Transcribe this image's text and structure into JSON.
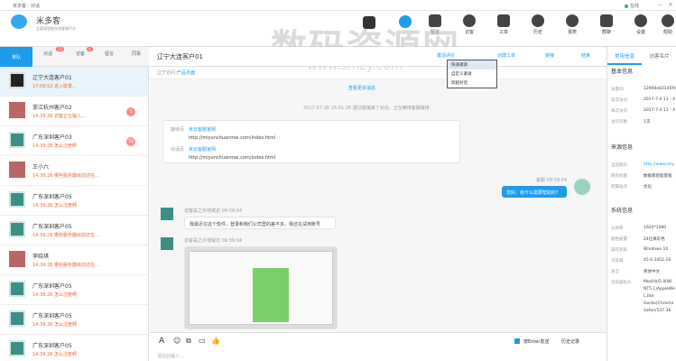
{
  "titlebar": {
    "title": "米多客 - 对话",
    "status": "在线"
  },
  "brand": {
    "name": "米多客",
    "sub": "全渠道智能在线客服平台"
  },
  "nav": [
    {
      "label": "留言"
    },
    {
      "label": "访客"
    },
    {
      "label": "工单"
    },
    {
      "label": "历史"
    },
    {
      "label": "报表"
    },
    {
      "label": "群聊"
    },
    {
      "label": "设置"
    },
    {
      "label": "帮助"
    }
  ],
  "left_tabs": {
    "active": "排队",
    "t2": "对话",
    "t2_count": "13",
    "t3": "访客",
    "t3_count": "4",
    "t4": "留言",
    "t5": "同事"
  },
  "sessions": [
    {
      "name": "辽宁大连客户01",
      "sub": "17:09:52 进入收发...",
      "selected": true,
      "count": ""
    },
    {
      "name": "浙江杭州客户02",
      "sub": "14:39:26 访客正在输入...",
      "count": "1"
    },
    {
      "name": "广东深圳客户03",
      "sub": "14:39:26 怎么注册啊",
      "count": "10"
    },
    {
      "name": "王小六",
      "sub": "14:39:26 哪些服务器目前还在...",
      "count": ""
    },
    {
      "name": "广东深圳客户05",
      "sub": "14:39:26 怎么注册啊",
      "count": ""
    },
    {
      "name": "广东深圳客户05",
      "sub": "14:39:26 哪些服务器目前还在...",
      "count": ""
    },
    {
      "name": "李晓琪",
      "sub": "14:39:26 哪些服务器目前还在...",
      "count": ""
    },
    {
      "name": "广东深圳客户05",
      "sub": "14:39:26 怎么注册啊",
      "count": ""
    },
    {
      "name": "广东深圳客户05",
      "sub": "14:39:26 怎么注册啊",
      "count": ""
    },
    {
      "name": "广东深圳客户05",
      "sub": "14:39:26 怎么注册啊",
      "count": ""
    }
  ],
  "chat": {
    "title": "辽宁大连客户01",
    "source_label": "辽宁访问：",
    "source_val": "产品页面",
    "actions": {
      "invite": "邀请评价",
      "create_ticket": "创建工单",
      "transfer": "转接",
      "end": "结束"
    },
    "dropdown": [
      "快速邀请",
      "自定义邀请",
      "跨越对话"
    ],
    "more": "查看更多消息",
    "sys_msg": "2017-07-26 15:01:26 通过链接来了对话，正在等待客服接待",
    "card": {
      "k1": "接待页",
      "v1": "米云客服官网",
      "u1": "http://miyunchuanmei.com/index.html",
      "k2": "对话页",
      "v2": "米云客服官网",
      "u2": "http://miyunchuanmei.com/index.html"
    },
    "me_time": "客服 09:39:04",
    "me_msg": "您好，有什么需要帮助的？",
    "v_time": "访客是之外地域访 09:39:04",
    "v_msg": "我最近在这个软件，登录和我们公司里的差不多，我还在试用账号",
    "v2_time": "访客是之外地域访 09:39:04",
    "send_tip": "按Enter发送",
    "history": "历史记录",
    "input_ph": "请在此输入..."
  },
  "right": {
    "tab1": "常用信息",
    "tab2": "访客名片",
    "sec1": "基本信息",
    "basic": [
      {
        "k": "访客ID",
        "v": "12900e83145f4"
      },
      {
        "k": "首次访问",
        "v": "2017-7-4 11 - 4"
      },
      {
        "k": "本次访问",
        "v": "2017-7-4 11 - 4"
      },
      {
        "k": "访问次数",
        "v": "1次"
      }
    ],
    "sec2": "来源信息",
    "source": [
      {
        "k": "当前网页",
        "v": "http://www.miy"
      },
      {
        "k": "网页标题",
        "v": "数据库智能客服"
      },
      {
        "k": "所属站点",
        "v": "优化"
      }
    ],
    "sec3": "系统信息",
    "sys": [
      {
        "k": "分辨率",
        "v": "1920*1080"
      },
      {
        "k": "颜色质量",
        "v": "24位真彩色"
      },
      {
        "k": "操作系统",
        "v": "Windows 10"
      },
      {
        "k": "浏览器",
        "v": "45.0.2452.18"
      },
      {
        "k": "语言",
        "v": "简体中文"
      },
      {
        "k": "浏览器标头",
        "v": "Mozilla/5.0(Wi"
      }
    ],
    "ua": [
      "NT5.1)AppleWe",
      "L,like",
      "Gecko)Chrome",
      "Safari/537.36"
    ]
  },
  "watermark": "数码资源网",
  "watermark_url": "www.smzy.com"
}
